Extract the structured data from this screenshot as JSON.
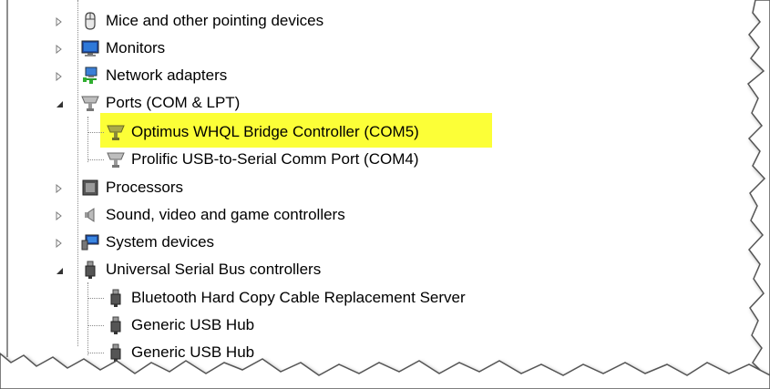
{
  "tree": {
    "categories": [
      {
        "label": "Mice and other pointing devices",
        "expanded": false,
        "icon": "mouse-icon"
      },
      {
        "label": "Monitors",
        "expanded": false,
        "icon": "monitor-icon"
      },
      {
        "label": "Network adapters",
        "expanded": false,
        "icon": "network-adapter-icon"
      },
      {
        "label": "Ports (COM & LPT)",
        "expanded": true,
        "icon": "port-icon",
        "children": [
          {
            "label": "Optimus WHQL Bridge Controller (COM5)",
            "highlighted": true,
            "icon": "port-icon"
          },
          {
            "label": "Prolific USB-to-Serial Comm Port (COM4)",
            "highlighted": false,
            "icon": "port-icon"
          }
        ]
      },
      {
        "label": "Processors",
        "expanded": false,
        "icon": "processor-icon"
      },
      {
        "label": "Sound, video and game controllers",
        "expanded": false,
        "icon": "speaker-icon"
      },
      {
        "label": "System devices",
        "expanded": false,
        "icon": "system-devices-icon"
      },
      {
        "label": "Universal Serial Bus controllers",
        "expanded": true,
        "icon": "usb-icon",
        "children": [
          {
            "label": "Bluetooth Hard Copy Cable Replacement Server",
            "icon": "usb-icon"
          },
          {
            "label": "Generic USB Hub",
            "icon": "usb-icon"
          },
          {
            "label": "Generic USB Hub",
            "icon": "usb-icon"
          }
        ]
      }
    ]
  },
  "colors": {
    "highlight": "#fcff37",
    "text": "#000000",
    "tree_lines": "#8a8a8a"
  }
}
